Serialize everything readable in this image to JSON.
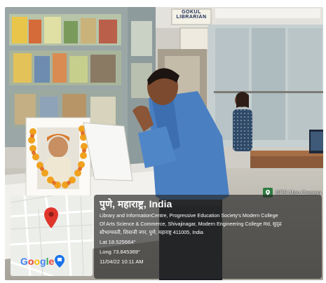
{
  "library_sign": {
    "line1": "GOKUL",
    "line2": "LIBRARIAN"
  },
  "gps_badge": {
    "label": "GPS Map Camera",
    "icon": "map-camera-icon"
  },
  "location": {
    "title": "पुणे, महाराष्ट्र, India",
    "address_line1": "Library and InformationCentre, Progressive Education Society's Modern College",
    "address_line2": "Of Arts Science & Commerce, Shivajinagar, Modern Engineering College Rd, सुदृढ",
    "address_line3": "सौभाग्यवती, शिवाजी नगर, पुणे, महाराष्ट्र 411005, India",
    "lat": "Lat 18.525664°",
    "long": "Long 73.845369°",
    "datetime": "11/04/22 10:11 AM"
  },
  "map": {
    "logo_text": "Google",
    "pin_icon": "map-pin-icon",
    "pin_color": "#e0352b"
  }
}
